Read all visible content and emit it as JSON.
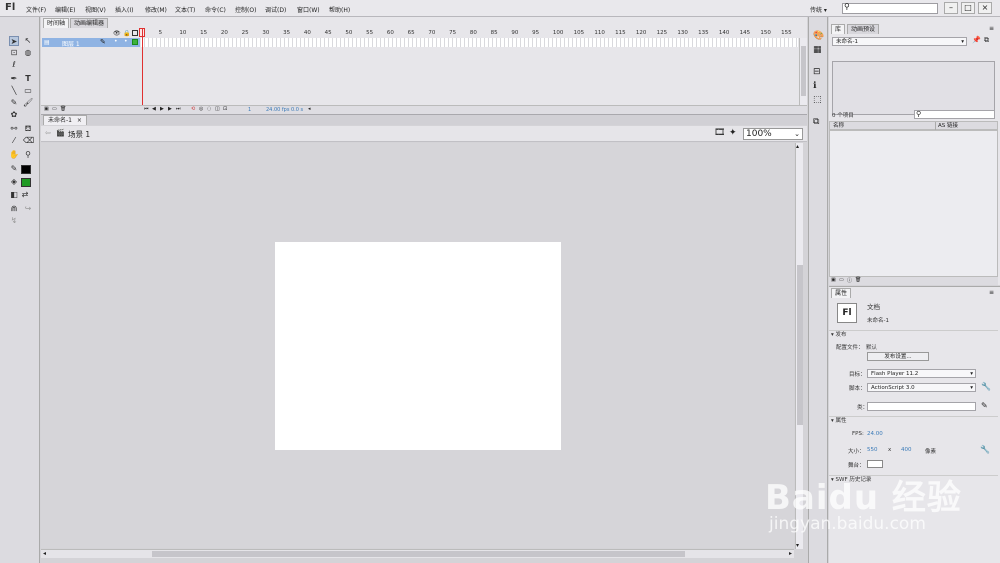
{
  "app": {
    "logo": "Fl"
  },
  "menubar": {
    "items": [
      "文件(F)",
      "编辑(E)",
      "视图(V)",
      "插入(I)",
      "修改(M)",
      "文本(T)",
      "命令(C)",
      "控制(O)",
      "调试(D)",
      "窗口(W)",
      "帮助(H)"
    ],
    "workspace": "传统 ▾"
  },
  "timeline": {
    "tabs": [
      "时间轴",
      "动画编辑器"
    ],
    "layer_name": "图层 1",
    "frame_numbers": [
      "1",
      "5",
      "10",
      "15",
      "20",
      "25",
      "30",
      "35",
      "40",
      "45",
      "50",
      "55",
      "60",
      "65",
      "70",
      "75",
      "80",
      "85",
      "90",
      "95",
      "100",
      "105",
      "110",
      "115",
      "120",
      "125",
      "130",
      "135",
      "140",
      "145",
      "150",
      "155"
    ],
    "current_frame": "1",
    "fps_readout": "24.00 fps",
    "time_readout": "0.0 s"
  },
  "document": {
    "tab": "未命名-1",
    "scene": "场景 1",
    "zoom": "100%"
  },
  "library": {
    "tabs": [
      "库",
      "动画预设"
    ],
    "doc_select": "未命名-1",
    "search_placeholder": "",
    "count": "0 个项目",
    "col_name": "名称",
    "col_link": "AS 链接"
  },
  "properties": {
    "tab": "属性",
    "type": "文档",
    "doc_name": "未命名-1",
    "publish_section": "发布",
    "profile_label": "配置文件：",
    "profile_value": "默认",
    "publish_settings_btn": "发布设置...",
    "target_label": "目标：",
    "target_value": "Flash Player 11.2",
    "script_label": "脚本：",
    "script_value": "ActionScript 3.0",
    "class_label": "类：",
    "props_section": "属性",
    "fps_label": "FPS:",
    "fps_value": "24.00",
    "size_label": "大小：",
    "width": "550",
    "x_sep": "x",
    "height": "400",
    "unit": "像素",
    "stage_label": "舞台：",
    "swf_section": "SWF 历史记录"
  },
  "watermark": {
    "brand": "Baidu 经验",
    "url": "jingyan.baidu.com"
  }
}
